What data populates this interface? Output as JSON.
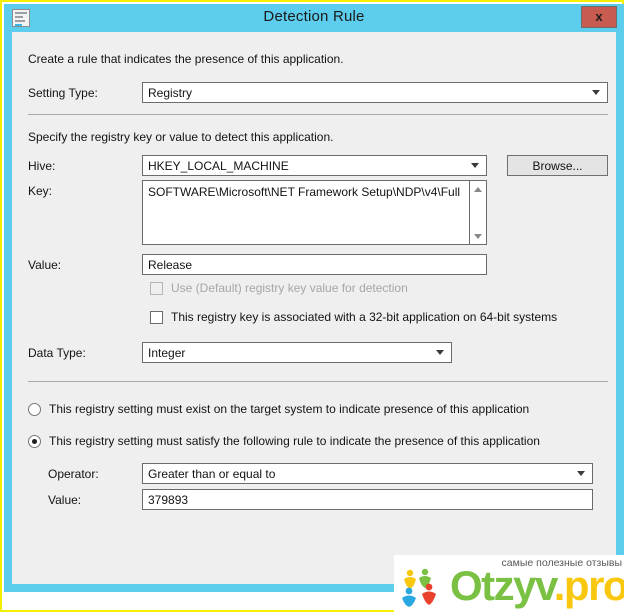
{
  "window": {
    "title": "Detection Rule",
    "icon": "registry-window-icon",
    "close_label": "x",
    "frame_color": "#5ccdec",
    "highlight_color": "#f5f000",
    "close_color": "#c75b4f"
  },
  "dialog": {
    "intro": "Create a rule that indicates the presence of this application.",
    "setting_type": {
      "label": "Setting Type:",
      "value": "Registry"
    },
    "section_registry": {
      "intro": "Specify the registry key or value to detect this application.",
      "hive": {
        "label": "Hive:",
        "value": "HKEY_LOCAL_MACHINE"
      },
      "browse_label": "Browse...",
      "key": {
        "label": "Key:",
        "value": "SOFTWARE\\Microsoft\\NET Framework Setup\\NDP\\v4\\Full"
      },
      "value_field": {
        "label": "Value:",
        "value": "Release"
      },
      "use_default_checkbox": {
        "label": "Use (Default) registry key value for detection",
        "checked": false,
        "enabled": false
      },
      "wow64_checkbox": {
        "label": "This registry key is associated with a 32-bit application on 64-bit systems",
        "checked": false,
        "enabled": true
      },
      "data_type": {
        "label": "Data Type:",
        "value": "Integer"
      }
    },
    "rule_options": {
      "exist_radio": {
        "label": "This registry setting must exist on the target system to indicate presence of this application",
        "selected": false
      },
      "satisfy_radio": {
        "label": "This registry setting must satisfy the following rule to indicate the presence of this application",
        "selected": true
      },
      "operator": {
        "label": "Operator:",
        "value": "Greater than or equal to"
      },
      "rule_value": {
        "label": "Value:",
        "value": "379893"
      }
    }
  },
  "watermark": {
    "tagline": "самые полезные отзывы",
    "brand_primary": "Otzyv",
    "brand_suffix": ".pro",
    "green": "#7ac143",
    "yellow": "#f9c80e"
  }
}
